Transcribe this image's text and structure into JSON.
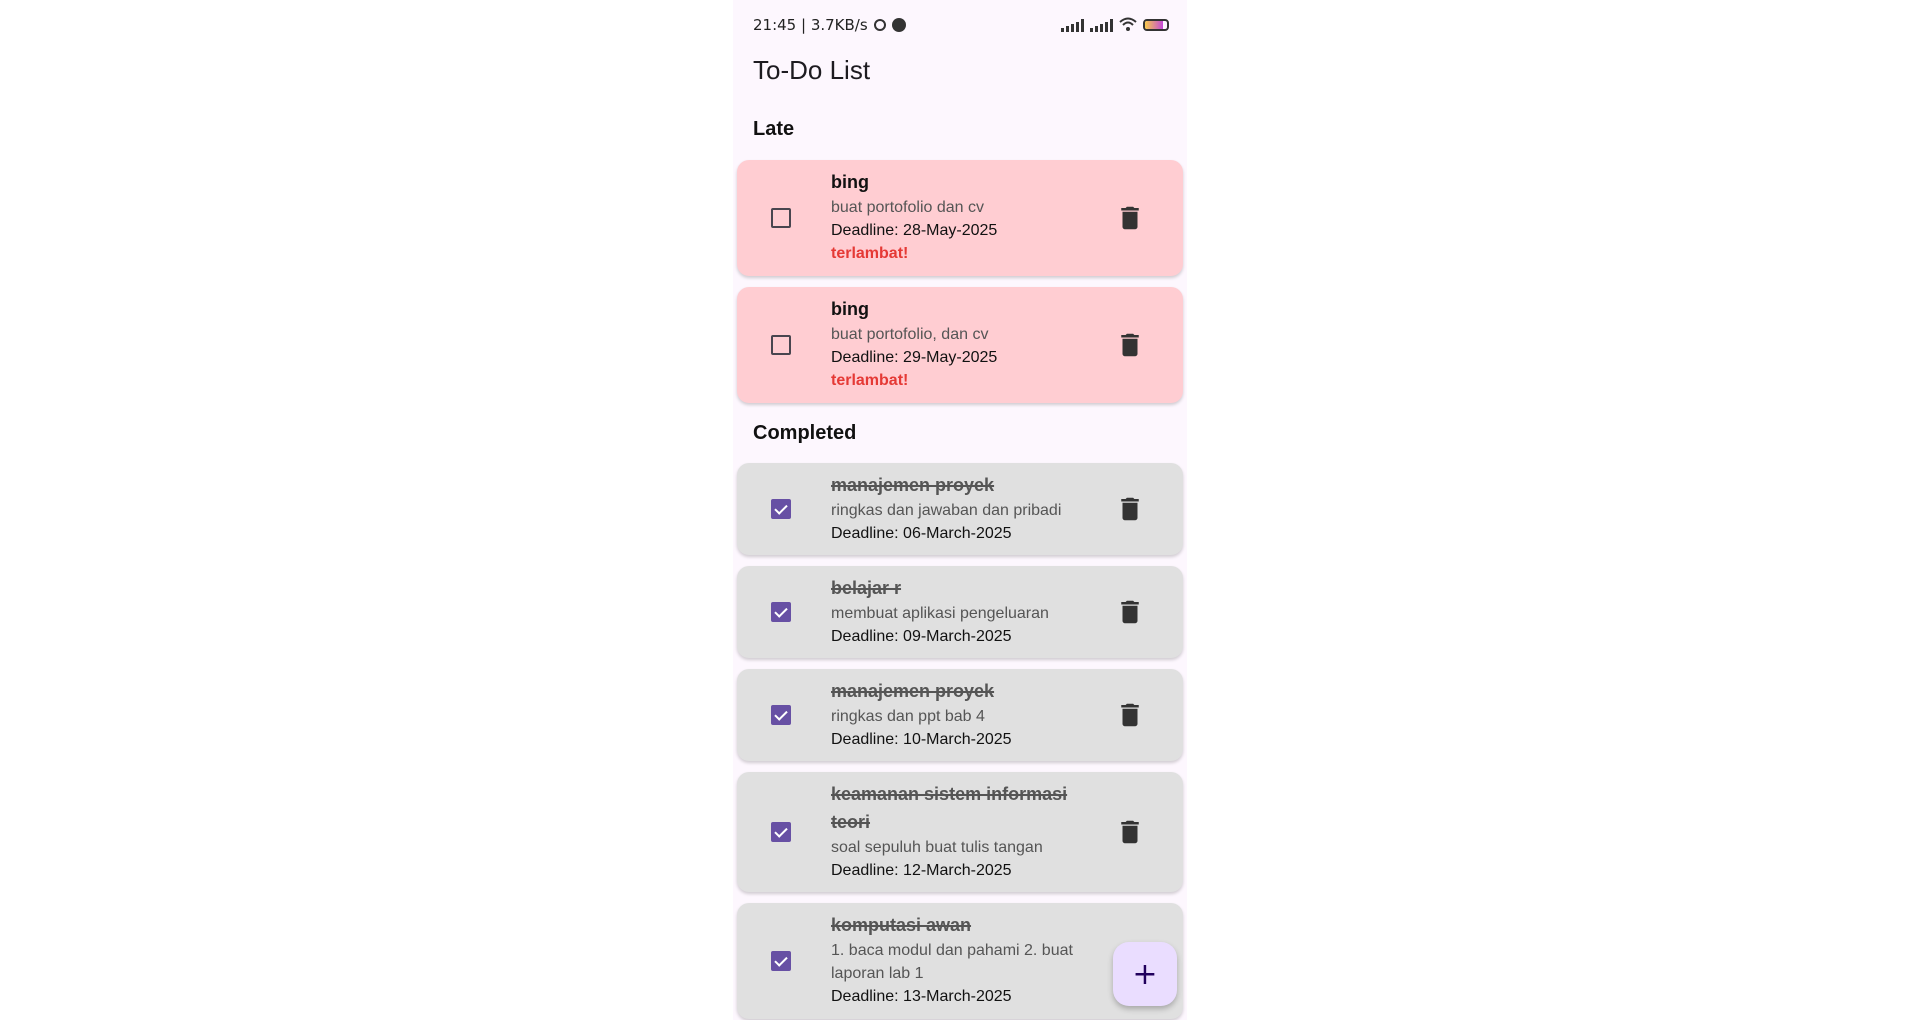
{
  "status_bar": {
    "time_speed": "21:45 | 3.7KB/s",
    "icons": [
      "alarm-icon",
      "status-dot-icon",
      "signal-icon",
      "signal-icon",
      "wifi-icon",
      "battery-icon"
    ],
    "battery_level": 0.8
  },
  "app": {
    "title": "To-Do List"
  },
  "sections": {
    "late": "Late",
    "completed": "Completed"
  },
  "tasks": [
    {
      "title": "bing",
      "desc": "buat portofolio dan cv",
      "deadline": "Deadline: 28-May-2025",
      "late_label": "terlambat!",
      "checked": false
    },
    {
      "title": "bing",
      "desc": "buat portofolio, dan cv",
      "deadline": "Deadline: 29-May-2025",
      "late_label": "terlambat!",
      "checked": false
    },
    {
      "title": "manajemen proyek",
      "desc": "ringkas dan jawaban dan pribadi",
      "deadline": "Deadline: 06-March-2025",
      "checked": true
    },
    {
      "title": "belajar r",
      "desc": "membuat aplikasi pengeluaran",
      "deadline": "Deadline: 09-March-2025",
      "checked": true
    },
    {
      "title": "manajemen proyek",
      "desc": "ringkas dan ppt bab 4",
      "deadline": "Deadline: 10-March-2025",
      "checked": true
    },
    {
      "title": "keamanan sistem informasi teori",
      "desc": "soal sepuluh buat tulis tangan",
      "deadline": "Deadline: 12-March-2025",
      "checked": true
    },
    {
      "title": "komputasi awan",
      "desc": "1. baca modul dan pahami  2. buat laporan lab 1",
      "deadline": "Deadline: 13-March-2025",
      "checked": true
    }
  ],
  "fab": {
    "label": "+",
    "icon": "add-icon"
  },
  "colors": {
    "late_card": "#ffcdd2",
    "done_card": "#e0e0e0",
    "late_text": "#e53935",
    "accent": "#6750a4",
    "fab_bg": "#eaddff"
  }
}
